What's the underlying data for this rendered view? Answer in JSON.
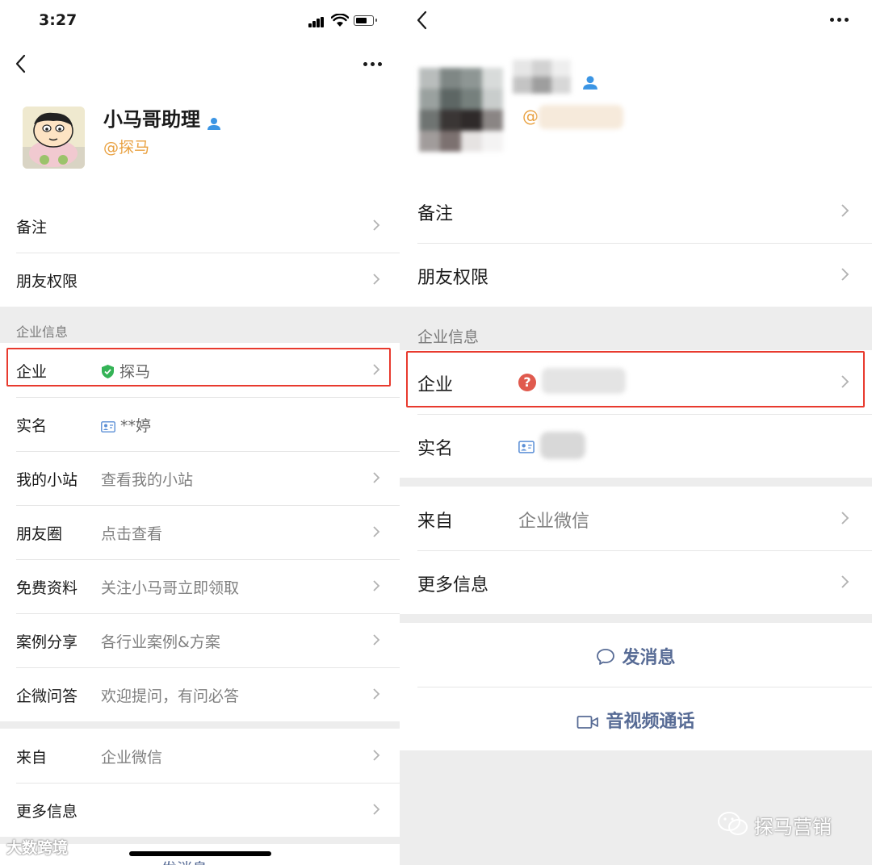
{
  "left": {
    "status": {
      "time": "3:27"
    },
    "profile": {
      "name": "小马哥助理",
      "handle": "@探马"
    },
    "rows_top": [
      {
        "label": "备注",
        "value": ""
      },
      {
        "label": "朋友权限",
        "value": ""
      }
    ],
    "section_label": "企业信息",
    "rows_enterprise": [
      {
        "label": "企业",
        "value": "探马"
      },
      {
        "label": "实名",
        "value": "**婷"
      },
      {
        "label": "我的小站",
        "value": "查看我的小站"
      },
      {
        "label": "朋友圈",
        "value": "点击查看"
      },
      {
        "label": "免费资料",
        "value": "关注小马哥立即领取"
      },
      {
        "label": "案例分享",
        "value": "各行业案例&方案"
      },
      {
        "label": "企微问答",
        "value": "欢迎提问，有问必答"
      }
    ],
    "rows_bottom": [
      {
        "label": "来自",
        "value": "企业微信"
      },
      {
        "label": "更多信息",
        "value": ""
      }
    ],
    "send_peek": "发消息",
    "watermark": "大数跨境"
  },
  "right": {
    "profile": {
      "handle_prefix": "@"
    },
    "rows_top": [
      {
        "label": "备注"
      },
      {
        "label": "朋友权限"
      }
    ],
    "section_label": "企业信息",
    "rows_enterprise": [
      {
        "label": "企业",
        "status_glyph": "?"
      },
      {
        "label": "实名"
      }
    ],
    "rows_bottom": [
      {
        "label": "来自",
        "value": "企业微信"
      },
      {
        "label": "更多信息"
      }
    ],
    "actions": {
      "send_message": "发消息",
      "av_call": "音视频通话"
    },
    "watermark": "探马营销"
  },
  "colors": {
    "accent_link": "#576b95",
    "handle_orange": "#e9a141",
    "highlight_red": "#e83a2e",
    "verified_green": "#34b356",
    "unverified_red": "#e05a4e",
    "user_badge_blue": "#3b95e4"
  },
  "icons": [
    "back-icon",
    "more-icon",
    "verified-user-icon",
    "chevron-right-icon",
    "shield-check-icon",
    "id-card-icon",
    "question-icon",
    "chat-bubble-icon",
    "video-camera-icon",
    "wechat-logo-icon"
  ]
}
